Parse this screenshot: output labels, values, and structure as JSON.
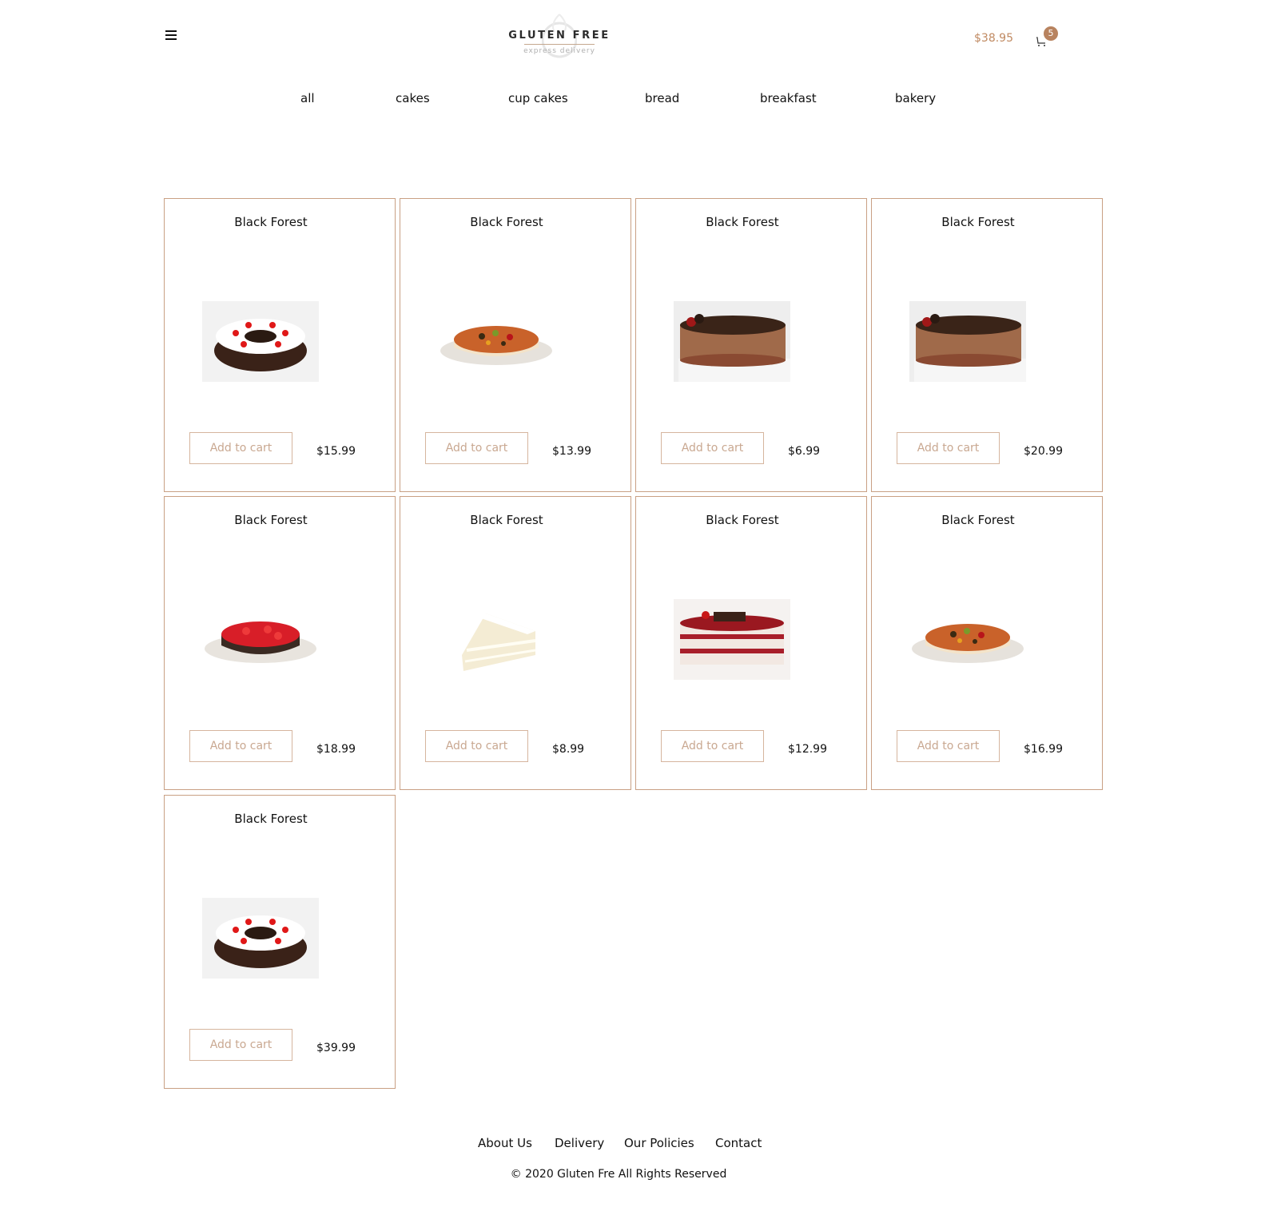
{
  "header": {
    "brand_title": "GLUTEN FREE",
    "brand_subtitle": "express delivery",
    "cart_total": "$38.95",
    "cart_count": "5",
    "accent_color": "#c08a62"
  },
  "nav": {
    "items": [
      {
        "label": "all"
      },
      {
        "label": "cakes"
      },
      {
        "label": "cup cakes"
      },
      {
        "label": "bread"
      },
      {
        "label": "breakfast"
      },
      {
        "label": "bakery"
      }
    ]
  },
  "products": [
    {
      "title": "Black Forest",
      "price": "$15.99",
      "button": "Add to cart",
      "image": "black-forest-cake-image"
    },
    {
      "title": "Black Forest",
      "price": "$13.99",
      "button": "Add to cart",
      "image": "fruit-cheesecake-image"
    },
    {
      "title": "Black Forest",
      "price": "$6.99",
      "button": "Add to cart",
      "image": "chocolate-strawberry-cake-image"
    },
    {
      "title": "Black Forest",
      "price": "$20.99",
      "button": "Add to cart",
      "image": "chocolate-strawberry-cake-image"
    },
    {
      "title": "Black Forest",
      "price": "$18.99",
      "button": "Add to cart",
      "image": "strawberry-glaze-cake-image"
    },
    {
      "title": "Black Forest",
      "price": "$8.99",
      "button": "Add to cart",
      "image": "vanilla-cake-slice-image"
    },
    {
      "title": "Black Forest",
      "price": "$12.99",
      "button": "Add to cart",
      "image": "red-velvet-layer-cake-image"
    },
    {
      "title": "Black Forest",
      "price": "$16.99",
      "button": "Add to cart",
      "image": "fruit-cheesecake-image"
    },
    {
      "title": "Black Forest",
      "price": "$39.99",
      "button": "Add to cart",
      "image": "black-forest-cake-image"
    }
  ],
  "footer": {
    "links": [
      {
        "label": "About Us"
      },
      {
        "label": "Delivery"
      },
      {
        "label": "Our Policies"
      },
      {
        "label": "Contact"
      }
    ],
    "copyright": "© 2020 Gluten Fre All Rights Reserved"
  }
}
